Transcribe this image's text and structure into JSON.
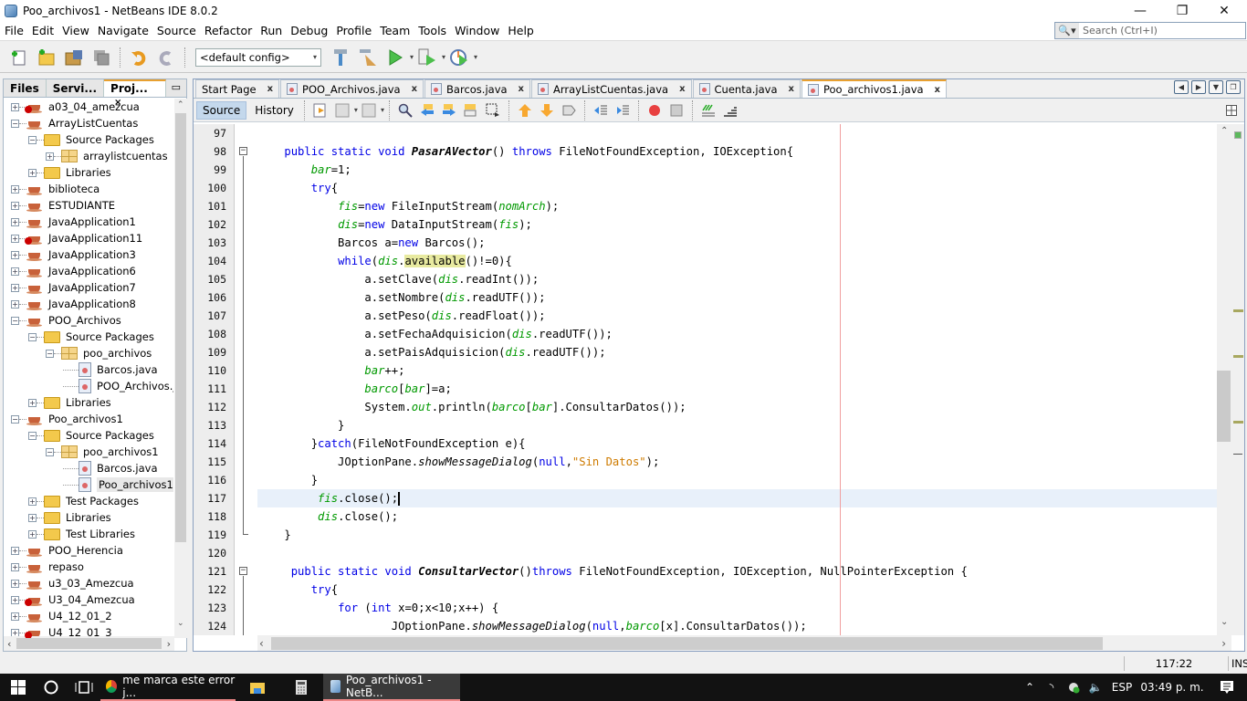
{
  "window": {
    "title": "Poo_archivos1 - NetBeans IDE 8.0.2",
    "minimize": "—",
    "restore": "❐",
    "close": "✕"
  },
  "menu": [
    "File",
    "Edit",
    "View",
    "Navigate",
    "Source",
    "Refactor",
    "Run",
    "Debug",
    "Profile",
    "Team",
    "Tools",
    "Window",
    "Help"
  ],
  "search": {
    "placeholder": "Search (Ctrl+I)",
    "icon": "magnifier-icon"
  },
  "toolbar": {
    "config": "<default config>",
    "buttons": [
      "new-file-icon",
      "new-project-icon",
      "open-project-icon",
      "save-all-icon",
      "undo-icon",
      "redo-icon",
      "build-hammer-icon",
      "clean-build-icon",
      "run-icon",
      "debug-icon",
      "profile-icon"
    ]
  },
  "left_panel": {
    "tabs": [
      {
        "label": "Files"
      },
      {
        "label": "Servi..."
      },
      {
        "label": "Proj...",
        "active": true,
        "close": "×"
      }
    ],
    "minimize": "▭",
    "tree": [
      {
        "label": "a03_04_amezcua",
        "type": "project",
        "error": true,
        "level": 0,
        "expander": "+"
      },
      {
        "label": "ArrayListCuentas",
        "type": "project",
        "level": 0,
        "expander": "−"
      },
      {
        "label": "Source Packages",
        "type": "folder",
        "level": 1,
        "expander": "−"
      },
      {
        "label": "arraylistcuentas",
        "type": "package",
        "level": 2,
        "expander": "+"
      },
      {
        "label": "Libraries",
        "type": "folder",
        "level": 1,
        "expander": "+"
      },
      {
        "label": "biblioteca",
        "type": "project",
        "level": 0,
        "expander": "+"
      },
      {
        "label": "ESTUDIANTE",
        "type": "project",
        "level": 0,
        "expander": "+"
      },
      {
        "label": "JavaApplication1",
        "type": "project",
        "level": 0,
        "expander": "+"
      },
      {
        "label": "JavaApplication11",
        "type": "project",
        "error": true,
        "level": 0,
        "expander": "+"
      },
      {
        "label": "JavaApplication3",
        "type": "project",
        "level": 0,
        "expander": "+"
      },
      {
        "label": "JavaApplication6",
        "type": "project",
        "level": 0,
        "expander": "+"
      },
      {
        "label": "JavaApplication7",
        "type": "project",
        "level": 0,
        "expander": "+"
      },
      {
        "label": "JavaApplication8",
        "type": "project",
        "level": 0,
        "expander": "+"
      },
      {
        "label": "POO_Archivos",
        "type": "project",
        "level": 0,
        "expander": "−"
      },
      {
        "label": "Source Packages",
        "type": "folder",
        "level": 1,
        "expander": "−"
      },
      {
        "label": "poo_archivos",
        "type": "package",
        "level": 2,
        "expander": "−"
      },
      {
        "label": "Barcos.java",
        "type": "file",
        "level": 3
      },
      {
        "label": "POO_Archivos.java",
        "type": "file",
        "level": 3
      },
      {
        "label": "Libraries",
        "type": "folder",
        "level": 1,
        "expander": "+"
      },
      {
        "label": "Poo_archivos1",
        "type": "project",
        "level": 0,
        "expander": "−"
      },
      {
        "label": "Source Packages",
        "type": "folder",
        "level": 1,
        "expander": "−"
      },
      {
        "label": "poo_archivos1",
        "type": "package",
        "level": 2,
        "expander": "−"
      },
      {
        "label": "Barcos.java",
        "type": "file",
        "level": 3
      },
      {
        "label": "Poo_archivos1.java",
        "type": "file",
        "level": 3,
        "selected": true
      },
      {
        "label": "Test Packages",
        "type": "folder",
        "level": 1,
        "expander": "+"
      },
      {
        "label": "Libraries",
        "type": "folder",
        "level": 1,
        "expander": "+"
      },
      {
        "label": "Test Libraries",
        "type": "folder",
        "level": 1,
        "expander": "+"
      },
      {
        "label": "POO_Herencia",
        "type": "project",
        "level": 0,
        "expander": "+"
      },
      {
        "label": "repaso",
        "type": "project",
        "level": 0,
        "expander": "+"
      },
      {
        "label": "u3_03_Amezcua",
        "type": "project",
        "level": 0,
        "expander": "+"
      },
      {
        "label": "U3_04_Amezcua",
        "type": "project",
        "error": true,
        "level": 0,
        "expander": "+"
      },
      {
        "label": "U4_12_01_2",
        "type": "project",
        "level": 0,
        "expander": "+"
      },
      {
        "label": "U4_12_01_3",
        "type": "project",
        "error": true,
        "level": 0,
        "expander": "+"
      }
    ]
  },
  "editor": {
    "tabs": [
      {
        "label": "Start Page",
        "icon": false
      },
      {
        "label": "POO_Archivos.java",
        "icon": true
      },
      {
        "label": "Barcos.java",
        "icon": true
      },
      {
        "label": "ArrayListCuentas.java",
        "icon": true
      },
      {
        "label": "Cuenta.java",
        "icon": true
      },
      {
        "label": "Poo_archivos1.java",
        "icon": true,
        "active": true
      }
    ],
    "tab_close": "x",
    "view_buttons": {
      "source": "Source",
      "history": "History"
    },
    "lines": [
      {
        "n": "97",
        "html": ""
      },
      {
        "n": "98",
        "html": "    <span class='kw'>public static void</span> <span class='mth'>PasarAVector</span>() <span class='kw'>throws</span> FileNotFoundException, IOException{"
      },
      {
        "n": "99",
        "html": "        <span class='fld'>bar</span>=1;"
      },
      {
        "n": "100",
        "html": "        <span class='kw'>try</span>{"
      },
      {
        "n": "101",
        "html": "            <span class='fld'>fis</span>=<span class='kw'>new</span> FileInputStream(<span class='fld'>nomArch</span>);"
      },
      {
        "n": "102",
        "html": "            <span class='fld'>dis</span>=<span class='kw'>new</span> DataInputStream(<span class='fld'>fis</span>);"
      },
      {
        "n": "103",
        "html": "            Barcos a=<span class='kw'>new</span> Barcos();"
      },
      {
        "n": "104",
        "html": "            <span class='kw'>while</span>(<span class='fld'>dis</span>.<span class='hl'>available</span>()!=0){"
      },
      {
        "n": "105",
        "html": "                a.setClave(<span class='fld'>dis</span>.readInt());"
      },
      {
        "n": "106",
        "html": "                a.setNombre(<span class='fld'>dis</span>.readUTF());"
      },
      {
        "n": "107",
        "html": "                a.setPeso(<span class='fld'>dis</span>.readFloat());"
      },
      {
        "n": "108",
        "html": "                a.setFechaAdquisicion(<span class='fld'>dis</span>.readUTF());"
      },
      {
        "n": "109",
        "html": "                a.setPaisAdquisicion(<span class='fld'>dis</span>.readUTF());"
      },
      {
        "n": "110",
        "html": "                <span class='fld'>bar</span>++;"
      },
      {
        "n": "111",
        "html": "                <span class='fld'>barco</span>[<span class='fld'>bar</span>]=a;"
      },
      {
        "n": "112",
        "html": "                System.<span class='fld'>out</span>.println(<span class='fld'>barco</span>[<span class='fld'>bar</span>].ConsultarDatos());"
      },
      {
        "n": "113",
        "html": "            }"
      },
      {
        "n": "114",
        "html": "        }<span class='kw'>catch</span>(FileNotFoundException e){"
      },
      {
        "n": "115",
        "html": "            JOptionPane.<span class='smth'>showMessageDialog</span>(<span class='kw'>null</span>,<span class='str'>\"Sin Datos\"</span>);"
      },
      {
        "n": "116",
        "html": "        }"
      },
      {
        "n": "117",
        "html": "         <span class='fld'>fis</span>.close();<span class='caretbar'></span>",
        "current": true
      },
      {
        "n": "118",
        "html": "         <span class='fld'>dis</span>.close();"
      },
      {
        "n": "119",
        "html": "    }"
      },
      {
        "n": "120",
        "html": ""
      },
      {
        "n": "121",
        "html": "     <span class='kw'>public static void</span> <span class='mth'>ConsultarVector</span>()<span class='kw'>throws</span> FileNotFoundException, IOException, NullPointerException {"
      },
      {
        "n": "122",
        "html": "        <span class='kw'>try</span>{"
      },
      {
        "n": "123",
        "html": "            <span class='kw'>for</span> (<span class='kw'>int</span> x=0;x&lt;10;x++) {"
      },
      {
        "n": "124",
        "html": "                    JOptionPane.<span class='smth'>showMessageDialog</span>(<span class='kw'>null</span>,<span class='fld'>barco</span>[x].ConsultarDatos());"
      }
    ]
  },
  "status": {
    "position": "117:22",
    "mode": "INS"
  },
  "taskbar": {
    "items": [
      {
        "label": "me marca este error j...",
        "app": "chrome"
      },
      {
        "label": "",
        "app": "file-explorer"
      },
      {
        "label": "",
        "app": "calculator"
      },
      {
        "label": "Poo_archivos1 - NetB...",
        "app": "netbeans",
        "active": true
      }
    ],
    "lang": "ESP",
    "time": "03:49 p. m."
  }
}
